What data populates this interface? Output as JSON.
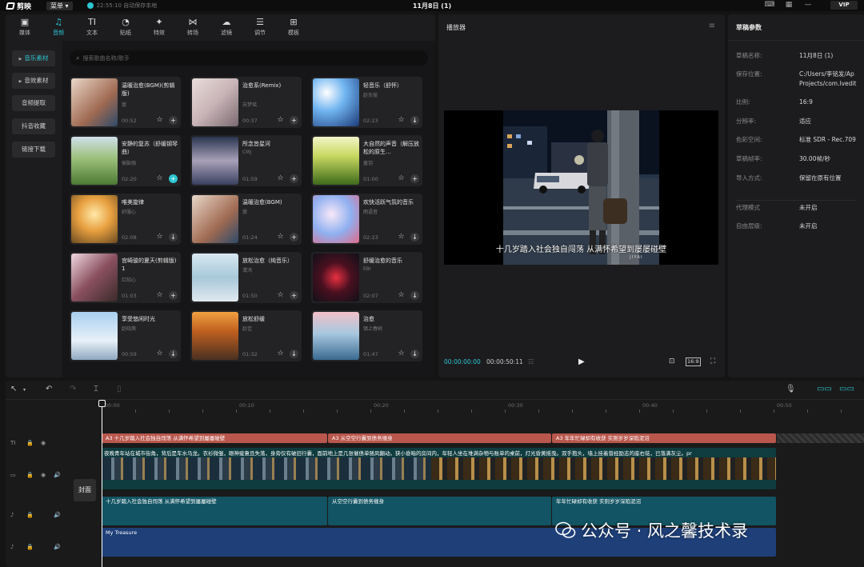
{
  "app": {
    "logo_text": "剪映",
    "menu_label": "菜单",
    "save_status": "22:55:10 自动保存本地",
    "project_title": "11月8日 (1)",
    "vip_label": "VIP"
  },
  "tabs": [
    {
      "label": "媒体",
      "icon": "media-icon"
    },
    {
      "label": "音频",
      "icon": "audio-icon",
      "active": true
    },
    {
      "label": "文本",
      "icon": "text-icon"
    },
    {
      "label": "贴纸",
      "icon": "sticker-icon"
    },
    {
      "label": "特效",
      "icon": "effects-icon"
    },
    {
      "label": "转场",
      "icon": "transition-icon"
    },
    {
      "label": "滤镜",
      "icon": "filter-icon"
    },
    {
      "label": "调节",
      "icon": "adjust-icon"
    },
    {
      "label": "模板",
      "icon": "template-icon"
    }
  ],
  "categories": [
    "音乐素材",
    "音效素材",
    "音频提取",
    "抖音收藏",
    "链接下载"
  ],
  "search": {
    "placeholder": "搜索歌曲名称/歌手"
  },
  "tracks": [
    {
      "title": "温暖治愈(BGM)(剪辑版)",
      "artist": "舅",
      "duration": "00:52",
      "action": "+"
    },
    {
      "title": "治愈系(Remix)",
      "artist": "苏梦瑶",
      "duration": "00:37",
      "action": "+"
    },
    {
      "title": "轻音乐（舒怀）",
      "artist": "赵东俊",
      "duration": "02:23",
      "action": "↓"
    },
    {
      "title": "安静的复苏（舒缓钢琴曲）",
      "artist": "侯胎强",
      "duration": "02:20",
      "action": "+"
    },
    {
      "title": "所念皆星河",
      "artist": "CMJ",
      "duration": "01:59",
      "action": "+"
    },
    {
      "title": "大自然的声音（解压放松的原生...",
      "artist": "童羽",
      "duration": "01:00",
      "action": "+"
    },
    {
      "title": "唯美旋律",
      "artist": "舒服心",
      "duration": "02:08",
      "action": "↓"
    },
    {
      "title": "温暖治愈(BGM)",
      "artist": "舅",
      "duration": "01:24",
      "action": "+"
    },
    {
      "title": "欢快活跃气氛的音乐",
      "artist": "雨语音",
      "duration": "02:23",
      "action": "↓"
    },
    {
      "title": "宫崎骏的夏天(剪辑版) 1",
      "artist": "红知心",
      "duration": "01:03",
      "action": "+"
    },
    {
      "title": "放松治愈（纯音乐）",
      "artist": "清鸿",
      "duration": "01:50",
      "action": "+"
    },
    {
      "title": "舒缓治愈的音乐",
      "artist": "E8r",
      "duration": "02:07",
      "action": "↓"
    },
    {
      "title": "享受悠闲时光",
      "artist": "赵晓茜",
      "duration": "00:59",
      "action": "↓"
    },
    {
      "title": "放松舒缓",
      "artist": "赵佳",
      "duration": "01:32",
      "action": "↓"
    },
    {
      "title": "治愈",
      "artist": "镇上春树",
      "duration": "01:47",
      "action": "↓"
    }
  ],
  "player": {
    "title": "播放器",
    "subtitle": "十几岁踏入社会独自闯荡 从满怀希望到屡屡碰壁",
    "watermark": "JIYAI",
    "current_time": "00:00:00:00",
    "total_time": "00:00:50:11",
    "ratio_label": "16:9"
  },
  "draft": {
    "title": "草稿参数",
    "rows": [
      {
        "key": "草稿名称:",
        "value": "11月8日 (1)"
      },
      {
        "key": "保存位置:",
        "value": "C:/Users/李铭发/Ap"
      },
      {
        "key": "",
        "value": "Projects/com.lvedit"
      },
      {
        "key": "比例:",
        "value": "16:9"
      },
      {
        "key": "分辨率:",
        "value": "适应"
      },
      {
        "key": "色彩空间:",
        "value": "标准 SDR - Rec.709"
      },
      {
        "key": "草稿帧率:",
        "value": "30.00帧/秒"
      },
      {
        "key": "导入方式:",
        "value": "保留在原有位置"
      }
    ],
    "rows2": [
      {
        "key": "代理模式",
        "value": "未开启"
      },
      {
        "key": "自由层级:",
        "value": "未开启"
      }
    ]
  },
  "timeline": {
    "ruler": [
      "00:00",
      "00:10",
      "00:20",
      "00:30",
      "00:40",
      "00:50"
    ],
    "cover_label": "封面",
    "text_segments": [
      "A3 十几岁踏入社会独自闯荡 从满怀希望到屡屡碰壁",
      "A3 从空空行囊到债务缠身",
      "A3 年年忙碌却有收获 实则岁岁深陷泥沼"
    ],
    "video_caption": "夜晚青年站在城市街角，背后是车水马龙。衣衫微皱，眼神疲惫且失落，身旁仅有破旧行囊，面前地上是几张催债单随风翻动。狭小昏暗的房间内，年轻人坐在堆满杂物与账单的桌前，灯光昏黄摇曳。双手抱头，墙上挂着曾经励志的座右铭，已落满灰尘。pr",
    "audio_segments": [
      "十几岁踏入社会独自闯荡 从满怀希望到屡屡碰壁",
      "从空空行囊到债务缠身",
      "年年忙碌却有收获 实则岁岁深陷泥沼"
    ],
    "music_label": "My Treasure"
  },
  "overlay_watermark": "公众号 · 风之馨技术录",
  "colors": {
    "accent": "#2ec5d3",
    "text_track": "#b9574c",
    "audio_track": "#125463",
    "music_track": "#1e3f78"
  }
}
